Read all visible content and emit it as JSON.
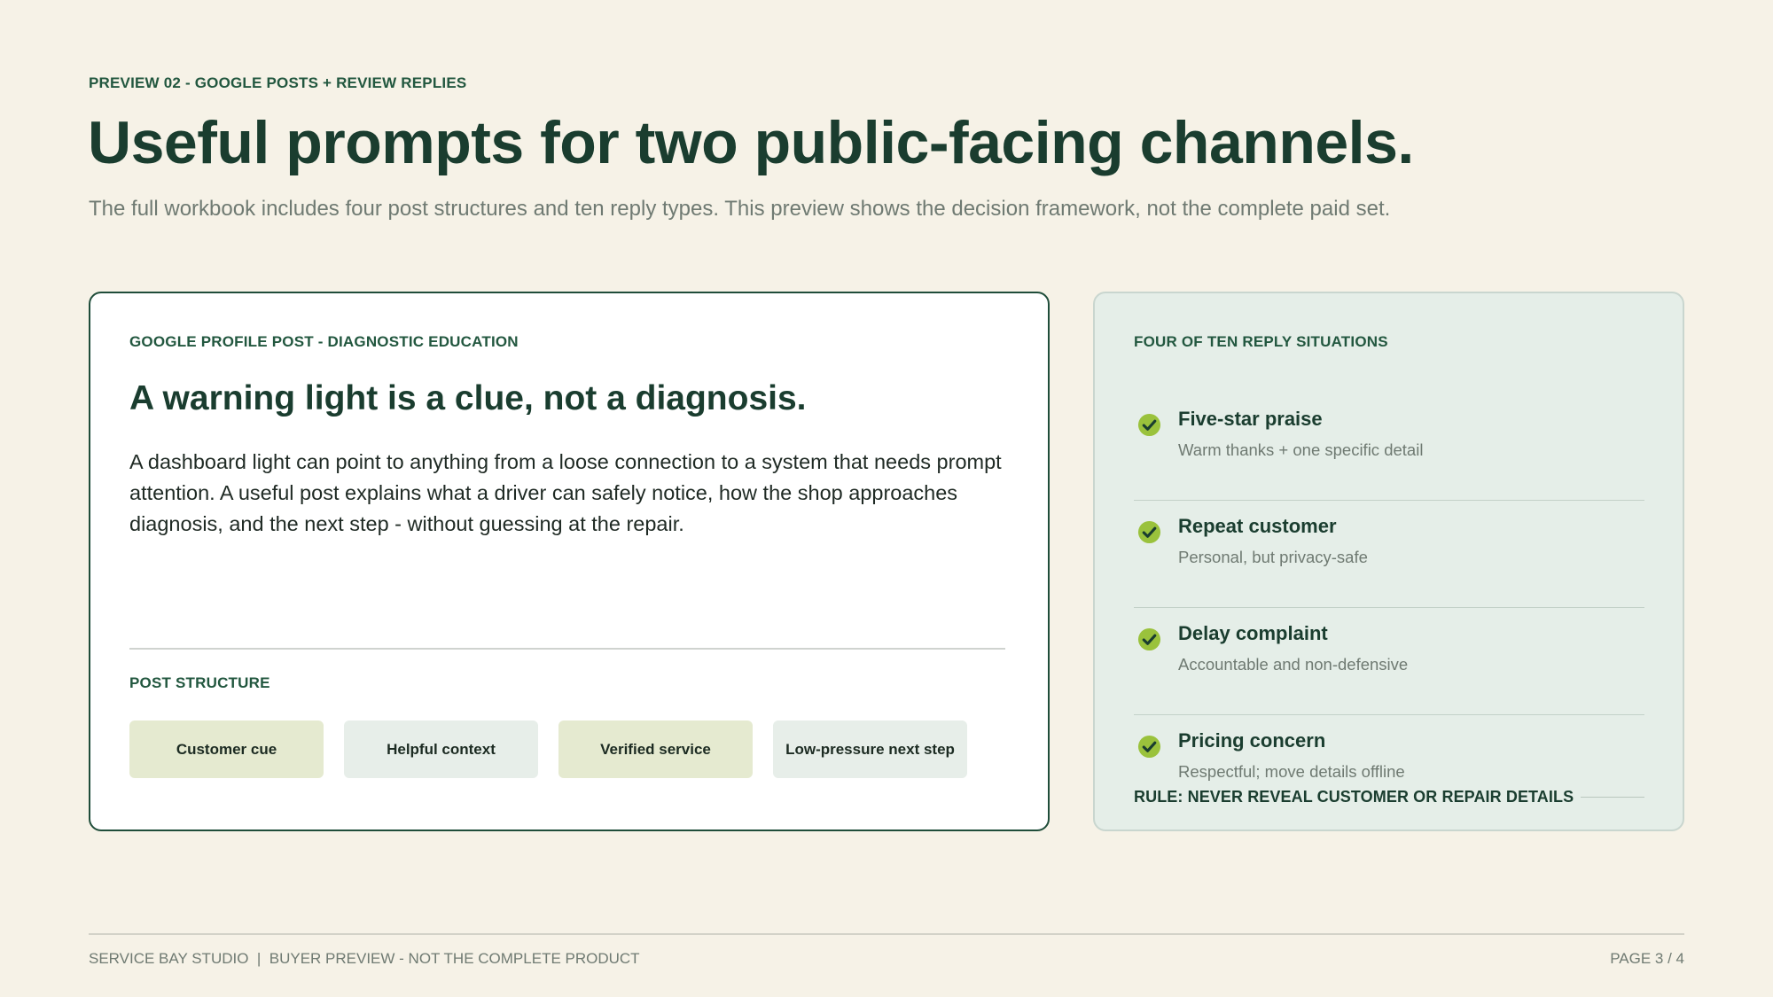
{
  "header": {
    "eyebrow": "PREVIEW 02 - GOOGLE POSTS + REVIEW REPLIES",
    "title": "Useful prompts for two public-facing channels.",
    "subtitle": "The full workbook includes four post structures and ten reply types. This preview shows the decision framework, not the complete paid set."
  },
  "post_card": {
    "eyebrow": "GOOGLE PROFILE POST - DIAGNOSTIC EDUCATION",
    "headline": "A warning light is a clue, not a diagnosis.",
    "body": "A dashboard light can point to anything from a loose connection to a system that needs prompt attention. A useful post explains what a driver can safely notice, how the shop approaches diagnosis, and the next step - without guessing at the repair.",
    "structure_label": "POST STRUCTURE",
    "chips": [
      {
        "label": "Customer cue",
        "tone": "green"
      },
      {
        "label": "Helpful context",
        "tone": "grey"
      },
      {
        "label": "Verified service",
        "tone": "green"
      },
      {
        "label": "Low-pressure next step",
        "tone": "grey"
      }
    ]
  },
  "reply_card": {
    "eyebrow": "FOUR OF TEN REPLY SITUATIONS",
    "items": [
      {
        "name": "Five-star praise",
        "desc": "Warm thanks + one specific detail",
        "icon": "check-circle-icon"
      },
      {
        "name": "Repeat customer",
        "desc": "Personal, but privacy-safe",
        "icon": "check-circle-icon"
      },
      {
        "name": "Delay complaint",
        "desc": "Accountable and non-defensive",
        "icon": "check-circle-icon"
      },
      {
        "name": "Pricing concern",
        "desc": "Respectful; move details offline",
        "icon": "check-circle-icon"
      }
    ],
    "rule": "RULE: NEVER REVEAL CUSTOMER OR REPAIR DETAILS"
  },
  "footer": {
    "left": "SERVICE BAY STUDIO  |  BUYER PREVIEW - NOT THE COMPLETE PRODUCT",
    "right": "PAGE 3 / 4"
  },
  "colors": {
    "background": "#f6f2e7",
    "primary_text": "#1a3d2f",
    "accent_green": "#9ac23c",
    "card_border": "#1f4d3a",
    "reply_card_bg": "#e5eee8"
  }
}
